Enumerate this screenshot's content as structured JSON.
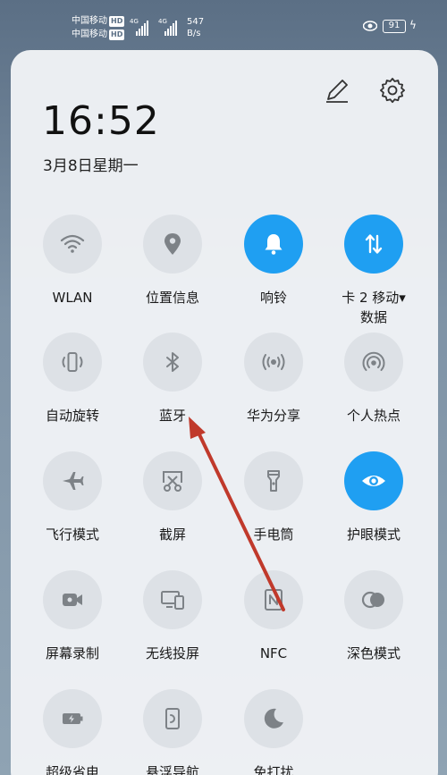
{
  "status_bar": {
    "carrier1": "中国移动",
    "carrier2": "中国移动",
    "hd": "HD",
    "net_type": "4G",
    "speed_value": "547",
    "speed_unit": "B/s",
    "battery": "91"
  },
  "header": {
    "time": "16:52",
    "date": "3月8日星期一",
    "edit_icon": "pencil-icon",
    "settings_icon": "gear-icon"
  },
  "tiles": [
    {
      "label": "WLAN",
      "icon": "wifi-icon",
      "active": false
    },
    {
      "label": "位置信息",
      "icon": "location-icon",
      "active": false
    },
    {
      "label": "响铃",
      "icon": "bell-icon",
      "active": true
    },
    {
      "label": "卡 2 移动▾",
      "label2": "数据",
      "icon": "mobile-data-icon",
      "active": true
    },
    {
      "label": "自动旋转",
      "icon": "rotate-icon",
      "active": false
    },
    {
      "label": "蓝牙",
      "icon": "bluetooth-icon",
      "active": false
    },
    {
      "label": "华为分享",
      "icon": "share-icon",
      "active": false
    },
    {
      "label": "个人热点",
      "icon": "hotspot-icon",
      "active": false
    },
    {
      "label": "飞行模式",
      "icon": "airplane-icon",
      "active": false
    },
    {
      "label": "截屏",
      "icon": "screenshot-icon",
      "active": false
    },
    {
      "label": "手电筒",
      "icon": "flashlight-icon",
      "active": false
    },
    {
      "label": "护眼模式",
      "icon": "eye-icon",
      "active": true
    },
    {
      "label": "屏幕录制",
      "icon": "screen-record-icon",
      "active": false
    },
    {
      "label": "无线投屏",
      "icon": "cast-icon",
      "active": false
    },
    {
      "label": "NFC",
      "icon": "nfc-icon",
      "active": false
    },
    {
      "label": "深色模式",
      "icon": "dark-mode-icon",
      "active": false
    },
    {
      "label": "超级省电",
      "icon": "battery-saver-icon",
      "active": false
    },
    {
      "label": "悬浮导航",
      "icon": "floating-nav-icon",
      "active": false
    },
    {
      "label": "免打扰",
      "icon": "moon-icon",
      "active": false
    }
  ],
  "colors": {
    "active": "#1f9ff2",
    "inactive": "#dde1e6",
    "arrow": "#c0392b"
  }
}
